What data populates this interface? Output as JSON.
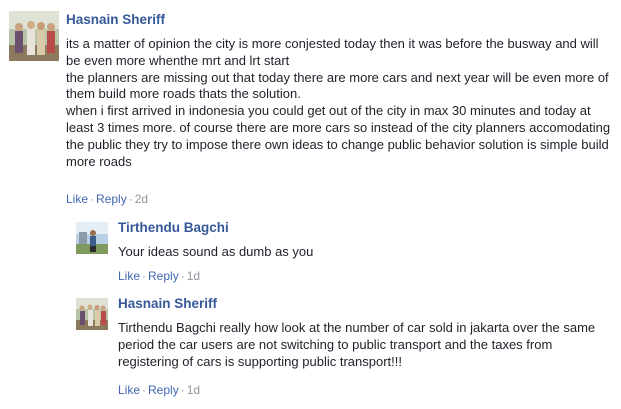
{
  "comments": [
    {
      "author": "Hasnain Sheriff",
      "lines": [
        "its a matter of opinion the city is more conjested today then it was before the busway and will be even more whenthe mrt and lrt start",
        "the planners are missing out that today there are more cars and next year will be even more of them build more roads thats the solution.",
        "when i first arrived in indonesia you could get out of the city in max 30 minutes and today at least 3 times more. of course there are more cars so instead of the city planners accomodating the public they try to impose there own ideas to change public behavior solution is simple build more roads"
      ],
      "like_label": "Like",
      "reply_label": "Reply",
      "time": "2d"
    },
    {
      "author": "Tirthendu Bagchi",
      "lines": [
        "Your ideas sound as dumb as you"
      ],
      "like_label": "Like",
      "reply_label": "Reply",
      "time": "1d"
    },
    {
      "author": "Hasnain Sheriff",
      "lines": [
        "Tirthendu Bagchi really how look at the number of car sold in jakarta over the same period the car users are not switching to public transport and the taxes from registering of cars is supporting public transport!!!"
      ],
      "like_label": "Like",
      "reply_label": "Reply",
      "time": "1d"
    }
  ],
  "separator": "·",
  "colors": {
    "author": "#365899",
    "link": "#4267b2",
    "meta": "#90949c",
    "text": "#1d2129"
  }
}
